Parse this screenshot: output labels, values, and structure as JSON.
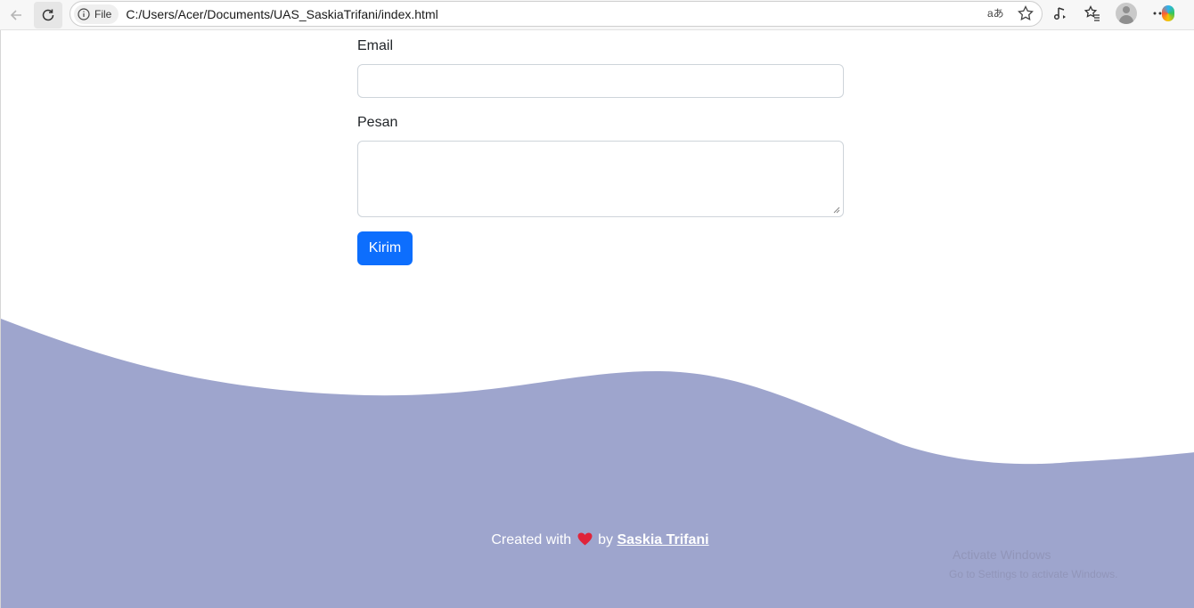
{
  "browser": {
    "file_chip_label": "File",
    "url": "C:/Users/Acer/Documents/UAS_SaskiaTrifani/index.html"
  },
  "form": {
    "email_label": "Email",
    "email_value": "",
    "message_label": "Pesan",
    "message_value": "",
    "submit_label": "Kirim"
  },
  "footer": {
    "prefix": "Created with",
    "by": "by",
    "author": "Saskia Trifani",
    "wave_color": "#9ea5cd",
    "heart_color": "#e0243a"
  },
  "watermark": {
    "line1": "Activate Windows",
    "line2": "Go to Settings to activate Windows."
  },
  "colors": {
    "primary_button": "#0d6efd",
    "page_background": "#ffffff"
  }
}
